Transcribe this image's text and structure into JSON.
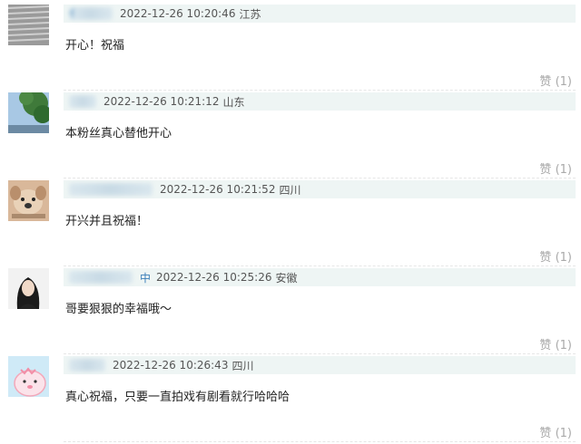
{
  "comments": [
    {
      "username_text": "亻",
      "time": "2022-12-26 10:20:46",
      "location": "江苏",
      "text": "开心！祝福",
      "like_label": "赞",
      "like_count": "(1)",
      "avatar": "stripes-avatar"
    },
    {
      "username_text": "",
      "time": "2022-12-26 10:21:12",
      "location": "山东",
      "text": "本粉丝真心替他开心",
      "like_label": "赞",
      "like_count": "(1)",
      "avatar": "tree-sky-avatar"
    },
    {
      "username_text": "",
      "time": "2022-12-26 10:21:52",
      "location": "四川",
      "text": "开兴并且祝福！",
      "like_label": "赞",
      "like_count": "(1)",
      "avatar": "dog-avatar"
    },
    {
      "username_text": "中",
      "time": "2022-12-26 10:25:26",
      "location": "安徽",
      "text": "哥要狠狠的幸福哦～",
      "like_label": "赞",
      "like_count": "(1)",
      "avatar": "girl-portrait-avatar"
    },
    {
      "username_text": "",
      "time": "2022-12-26 10:26:43",
      "location": "四川",
      "text": "真心祝福，只要一直拍戏有剧看就行哈哈哈",
      "like_label": "赞",
      "like_count": "(1)",
      "avatar": "pink-cartoon-avatar"
    }
  ]
}
